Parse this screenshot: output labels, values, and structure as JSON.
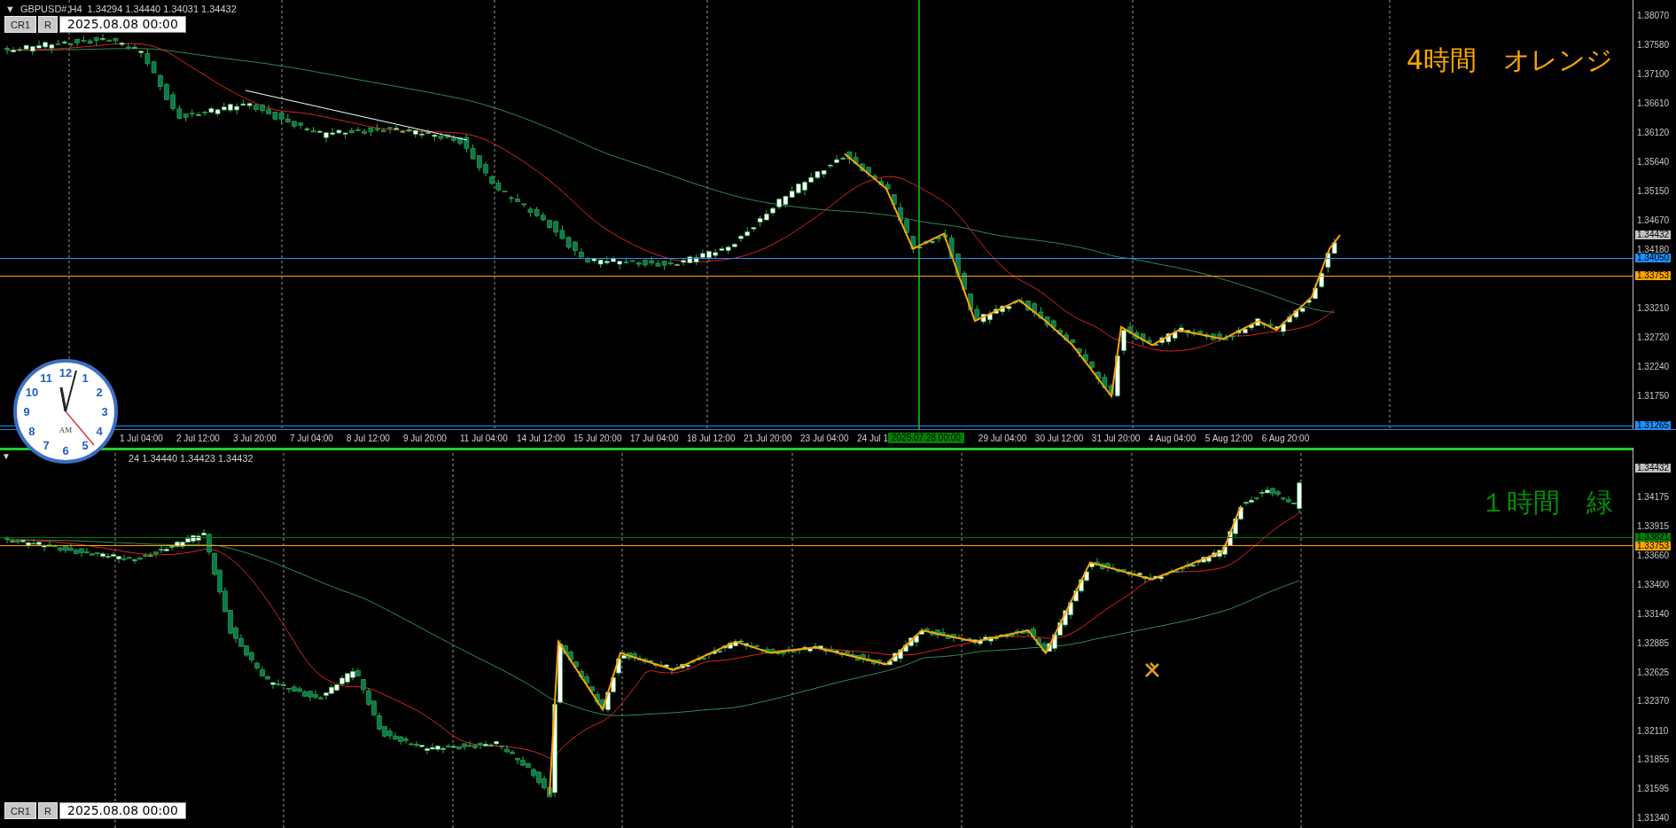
{
  "top_chart": {
    "menu_glyph": "▼",
    "symbol": "GBPUSD#,H4",
    "ohlc": "1.34294 1.34440 1.34031 1.34432",
    "toolbar": {
      "buttons": [
        "CR1",
        "R"
      ],
      "date_field": "2025.08.08 00:00"
    },
    "caption": "4時間　オレンジ",
    "price_axis": [
      "1.38070",
      "1.37580",
      "1.37100",
      "1.36610",
      "1.36120",
      "1.35640",
      "1.35150",
      "1.34670",
      "1.34180",
      "1.33210",
      "1.32720",
      "1.32240",
      "1.31750"
    ],
    "price_tags": [
      {
        "text": "1.34432",
        "color": "#c0c0c0",
        "line": false
      },
      {
        "text": "1.34050",
        "color": "#1e90ff",
        "line": true
      },
      {
        "text": "1.33753",
        "color": "#ffa500",
        "line": true
      },
      {
        "text": "1.31265",
        "color": "#1e90ff",
        "line": true
      }
    ],
    "time_axis": [
      {
        "kind": "label",
        "text": "1 Jul 04:00"
      },
      {
        "kind": "label",
        "text": "2 Jul 12:00"
      },
      {
        "kind": "label",
        "text": "3 Jul 20:00"
      },
      {
        "kind": "label",
        "text": "7 Jul 04:00"
      },
      {
        "kind": "label",
        "text": "8 Jul 12:00"
      },
      {
        "kind": "label",
        "text": "9 Jul 20:00"
      },
      {
        "kind": "label",
        "text": "11 Jul 04:00"
      },
      {
        "kind": "label",
        "text": "14 Jul 12:00"
      },
      {
        "kind": "label",
        "text": "15 Jul 20:00"
      },
      {
        "kind": "label",
        "text": "17 Jul 04:00"
      },
      {
        "kind": "label",
        "text": "18 Jul 12:00"
      },
      {
        "kind": "label",
        "text": "21 Jul 20:00"
      },
      {
        "kind": "label",
        "text": "23 Jul 04:00"
      },
      {
        "kind": "label",
        "text": "24 Jul 1"
      },
      {
        "kind": "marker",
        "text": "2025.07.28 00:00"
      },
      {
        "kind": "label",
        "text": "29 Jul 04:00"
      },
      {
        "kind": "label",
        "text": "30 Jul 12:00"
      },
      {
        "kind": "label",
        "text": "31 Jul 20:00"
      },
      {
        "kind": "label",
        "text": "4 Aug 04:00"
      },
      {
        "kind": "label",
        "text": "5 Aug 12:00"
      },
      {
        "kind": "label",
        "text": "6 Aug 20:00"
      }
    ]
  },
  "bottom_chart": {
    "menu_glyph": "▼",
    "ohlc": "24 1.34440 1.34423 1.34432",
    "toolbar": {
      "buttons": [
        "CR1",
        "R"
      ],
      "date_field": "2025.08.08 00:00"
    },
    "caption": "１時間　緑",
    "price_axis": [
      "1.34175",
      "1.33915",
      "1.33660",
      "1.33400",
      "1.33140",
      "1.32885",
      "1.32625",
      "1.32370",
      "1.32110",
      "1.31855",
      "1.31595",
      "1.31340"
    ],
    "price_tags": [
      {
        "text": "1.34432",
        "color": "#c0c0c0",
        "line": false
      },
      {
        "text": "1.33821",
        "color": "#008000",
        "line": true
      },
      {
        "text": "1.33753",
        "color": "#ffa500",
        "line": true
      }
    ]
  },
  "clock": {
    "numerals": [
      "12",
      "11",
      "1",
      "10",
      "2",
      "9",
      "3",
      "8",
      "4",
      "7",
      "5",
      "6"
    ],
    "meridiem": "AM"
  }
}
